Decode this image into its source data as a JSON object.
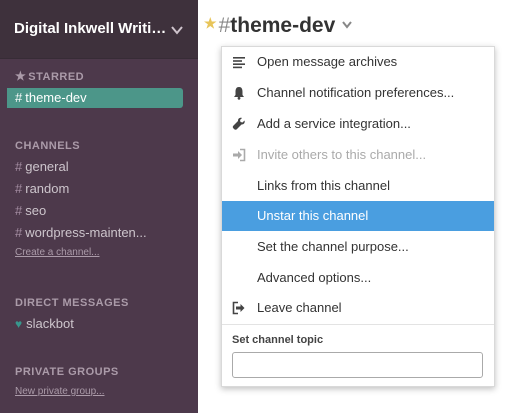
{
  "sidebar": {
    "team_name": "Digital Inkwell Writin...",
    "starred": {
      "title": "STARRED",
      "items": [
        {
          "label": "theme-dev"
        }
      ]
    },
    "channels": {
      "title": "CHANNELS",
      "items": [
        {
          "label": "general"
        },
        {
          "label": "random"
        },
        {
          "label": "seo"
        },
        {
          "label": "wordpress-mainten..."
        }
      ],
      "create_link": "Create a channel..."
    },
    "direct_messages": {
      "title": "DIRECT MESSAGES",
      "items": [
        {
          "label": "slackbot"
        }
      ]
    },
    "private_groups": {
      "title": "PRIVATE GROUPS",
      "new_link": "New private group..."
    }
  },
  "header": {
    "hash": "#",
    "channel_name": "theme-dev"
  },
  "menu": {
    "items": [
      {
        "label": "Open message archives",
        "icon": "list-icon"
      },
      {
        "label": "Channel notification preferences...",
        "icon": "bell-icon"
      },
      {
        "label": "Add a service integration...",
        "icon": "wrench-icon"
      },
      {
        "label": "Invite others to this channel...",
        "icon": "sign-in-icon",
        "disabled": true
      },
      {
        "label": "Links from this channel"
      },
      {
        "label": "Unstar this channel",
        "highlighted": true
      },
      {
        "label": "Set the channel purpose..."
      },
      {
        "label": "Advanced options..."
      },
      {
        "label": "Leave channel",
        "icon": "sign-out-icon"
      }
    ],
    "topic_label": "Set channel topic",
    "topic_value": ""
  },
  "colors": {
    "sidebar_bg": "#4d394b",
    "active_item": "#4c9689",
    "highlight": "#4a9ee0",
    "star": "#e8c55a"
  }
}
